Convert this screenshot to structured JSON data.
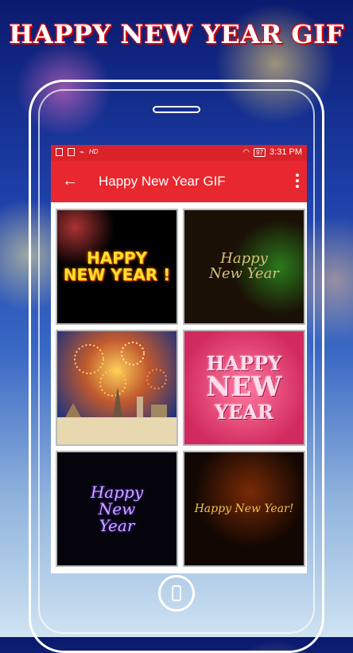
{
  "banner": {
    "title": "HAPPY NEW YEAR GIF"
  },
  "statusbar": {
    "battery": "97",
    "time": "3:31 PM",
    "hd": "HD"
  },
  "toolbar": {
    "title": "Happy New Year GIF",
    "back_icon": "arrow-back-icon",
    "menu_icon": "more-vert-icon"
  },
  "colors": {
    "toolbar": "#e9272e",
    "statusbar": "#d9222a",
    "banner_outline": "#e8141c"
  },
  "gallery": {
    "tiles": [
      {
        "lines": [
          "HAPPY",
          "NEW YEAR !"
        ]
      },
      {
        "lines": [
          "Happy",
          "New Year"
        ]
      },
      {
        "lines": []
      },
      {
        "lines": [
          "HAPPY",
          "NEW",
          "YEAR"
        ]
      },
      {
        "lines": [
          "Happy",
          "New",
          "Year"
        ]
      },
      {
        "lines": [
          "Happy New Year!"
        ]
      }
    ]
  }
}
